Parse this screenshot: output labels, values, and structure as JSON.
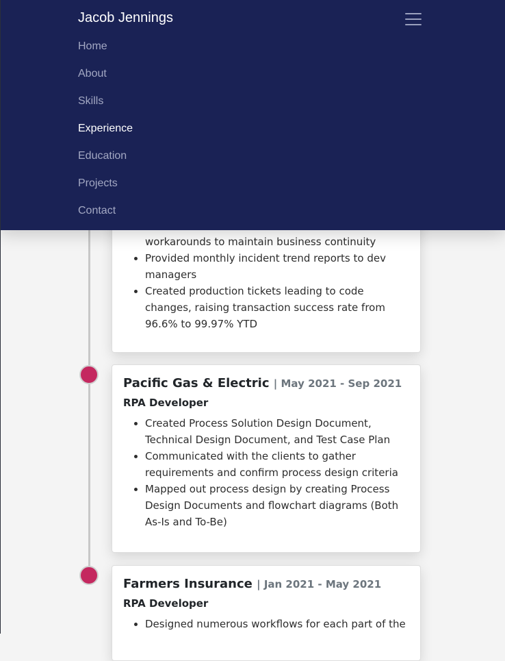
{
  "navbar": {
    "brand": "Jacob Jennings",
    "items": [
      {
        "label": "Home"
      },
      {
        "label": "About"
      },
      {
        "label": "Skills"
      },
      {
        "label": "Experience"
      },
      {
        "label": "Education"
      },
      {
        "label": "Projects"
      },
      {
        "label": "Contact"
      }
    ],
    "active": "Experience",
    "toggler_icon": "hamburger-menu-icon"
  },
  "experience": {
    "previous_card": {
      "bullets": [
        "workarounds to maintain business continuity",
        "Provided monthly incident trend reports to dev managers",
        "Created production tickets leading to code changes, raising transaction success rate from 96.6% to 99.97% YTD"
      ]
    },
    "jobs": [
      {
        "company": "Pacific Gas & Electric",
        "dates": "| May 2021 - Sep 2021",
        "role": "RPA Developer",
        "bullets": [
          "Created Process Solution Design Document, Technical Design Document, and Test Case Plan",
          "Communicated with the clients to gather requirements and confirm process design criteria",
          "Mapped out process design by creating Process Design Documents and flowchart diagrams (Both As-Is and To-Be)"
        ]
      },
      {
        "company": "Farmers Insurance",
        "dates": "| Jan 2021 - May 2021",
        "role": "RPA Developer",
        "bullets": [
          "Designed numerous workflows for each part of the"
        ]
      }
    ]
  },
  "colors": {
    "navbar_bg": "#1a2255",
    "timeline_dot": "#c4285f",
    "timeline_line": "#c8c8c8",
    "page_bg": "#f4f4f4"
  }
}
